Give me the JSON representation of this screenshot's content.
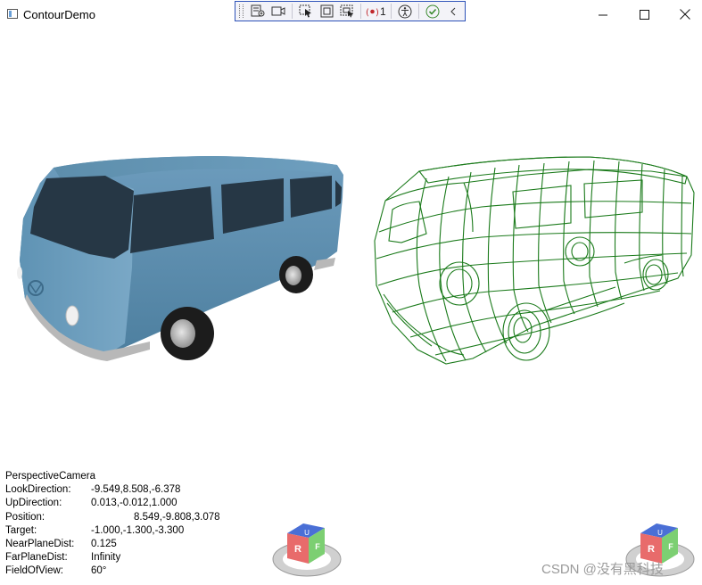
{
  "window": {
    "title": "ContourDemo",
    "minimize_icon": "minimize-icon",
    "maximize_icon": "maximize-icon",
    "close_icon": "close-icon"
  },
  "debug_toolbar": {
    "icons": [
      "go-to-live-visual-tree-icon",
      "display-layout-adorners-icon",
      "select-element-icon",
      "display-layout-bounds-icon",
      "track-focus-icon",
      "binding-failures-icon",
      "accessibility-icon",
      "hot-reload-ok-icon",
      "collapse-chevron-icon"
    ],
    "binding_failures_count": "1"
  },
  "scene": {
    "left_model": "solid-van-model",
    "right_model": "wireframe-van-model",
    "wire_color": "#1a7a1a",
    "van_color": "#5b8fb0"
  },
  "camera_info": {
    "title": "PerspectiveCamera",
    "rows": [
      {
        "label": "LookDirection:",
        "value": "-9.549,8.508,-6.378"
      },
      {
        "label": "UpDirection:",
        "value": "0.013,-0.012,1.000"
      },
      {
        "label": "Position:",
        "value": "8.549,-9.808,3.078"
      },
      {
        "label": "Target:",
        "value": "-1.000,-1.300,-3.300"
      },
      {
        "label": "NearPlaneDist:",
        "value": "0.125"
      },
      {
        "label": "FarPlaneDist:",
        "value": "Infinity"
      },
      {
        "label": "FieldOfView:",
        "value": "60°"
      }
    ]
  },
  "view_cubes": {
    "left": {
      "face_top": "U",
      "face_left": "R",
      "face_right": "F"
    },
    "right": {
      "face_top": "U",
      "face_left": "R",
      "face_right": "F"
    }
  },
  "watermark": "CSDN @没有黑科技"
}
